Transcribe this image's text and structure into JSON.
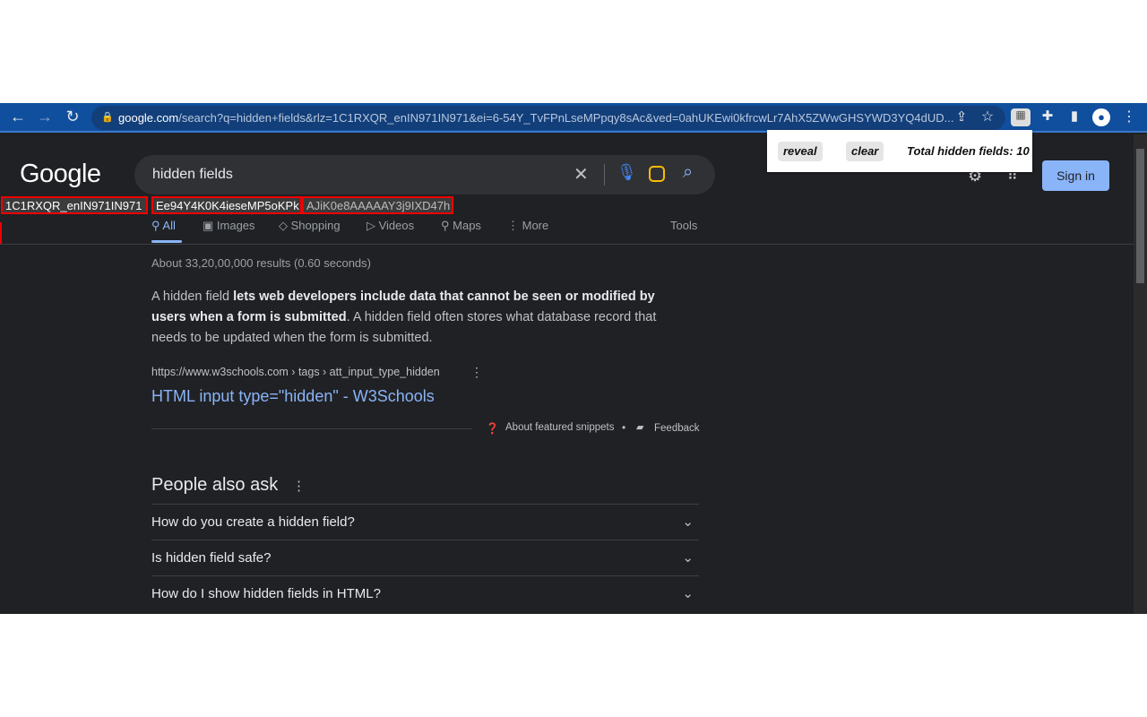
{
  "browser": {
    "url_host": "google.com",
    "url_path": "/search?q=hidden+fields&rlz=1C1RXQR_enIN971IN971&ei=6-54Y_TvFPnLseMPpqy8sAc&ved=0ahUKEwi0kfrcwLr7AhX5ZWwGHSYWD3YQ4dUD..."
  },
  "popup": {
    "reveal": "reveal",
    "clear": "clear",
    "total": "Total hidden fields: 10"
  },
  "google": {
    "logo": "Google",
    "query": "hidden fields",
    "sign_in": "Sign in"
  },
  "hidden_fields": [
    "1C1RXQR_enIN971IN971",
    "Ee94Y4K0K4ieseMP5oKPk",
    "AJiK0e8AAAAAY3j9IXD47h"
  ],
  "tabs": [
    "All",
    "Images",
    "Shopping",
    "Videos",
    "Maps",
    "More",
    "Tools"
  ],
  "results": {
    "stats": "About 33,20,00,000 results (0.60 seconds)",
    "snippet_pre": "A hidden field ",
    "snippet_bold": "lets web developers include data that cannot be seen or modified by users when a form is submitted",
    "snippet_post": ". A hidden field often stores what database record that needs to be updated when the form is submitted.",
    "cite": "https://www.w3schools.com › tags › att_input_type_hidden",
    "title": "HTML input type=\"hidden\" - W3Schools",
    "about": "About featured snippets",
    "feedback": "Feedback"
  },
  "paa": {
    "heading": "People also ask",
    "questions": [
      "How do you create a hidden field?",
      "Is hidden field safe?",
      "How do I show hidden fields in HTML?"
    ]
  }
}
